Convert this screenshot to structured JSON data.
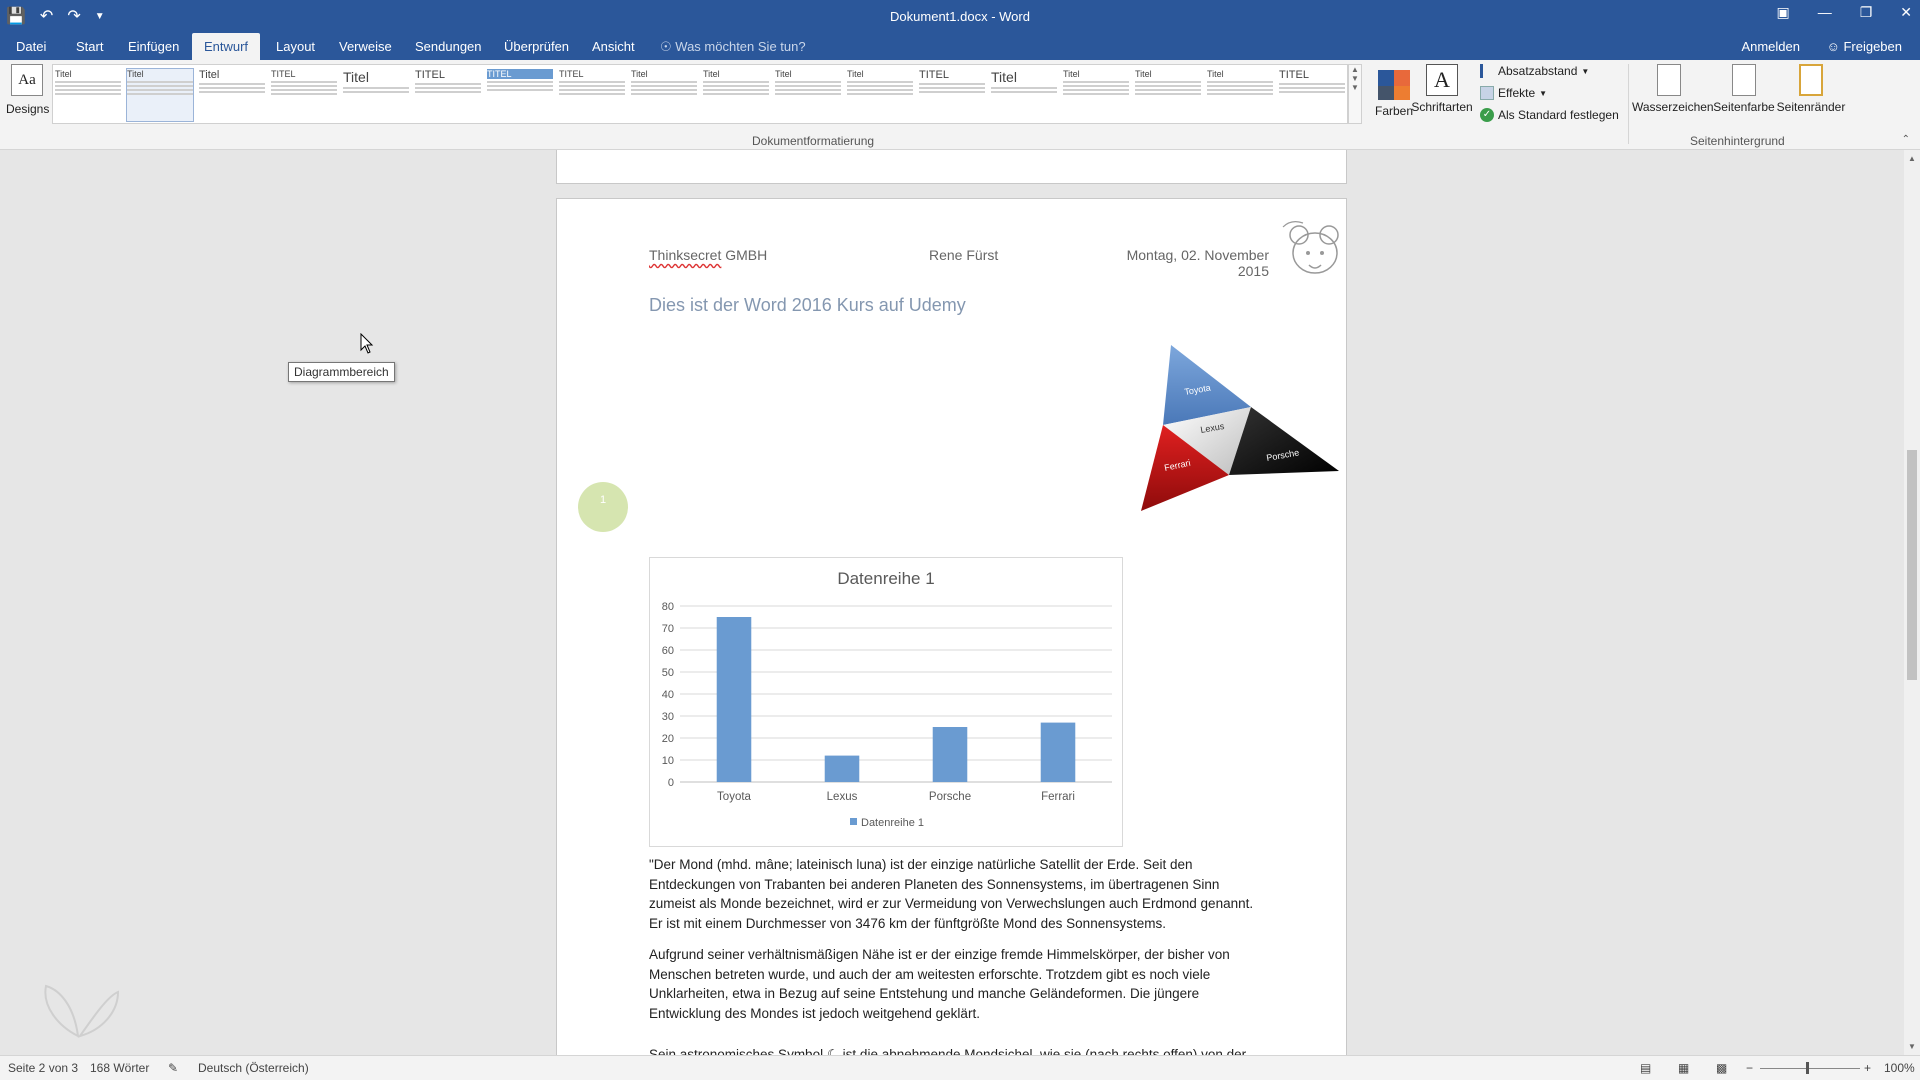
{
  "titlebar": {
    "title": "Dokument1.docx - Word"
  },
  "tabs": [
    "Datei",
    "Start",
    "Einfügen",
    "Entwurf",
    "Layout",
    "Verweise",
    "Sendungen",
    "Überprüfen",
    "Ansicht"
  ],
  "tellme": "Was möchten Sie tun?",
  "signin": "Anmelden",
  "share": "Freigeben",
  "ribbon": {
    "designs_label": "Designs",
    "group_label": "Dokumentformatierung",
    "farben": "Farben",
    "schriftarten": "Schriftarten",
    "absatzabstand": "Absatzabstand",
    "effekte": "Effekte",
    "standard": "Als Standard festlegen",
    "wasserzeichen": "Wasserzeichen",
    "seitenfarbe": "Seitenfarbe",
    "seitenraender": "Seitenränder",
    "bg_group_label": "Seitenhintergrund",
    "style_titles": [
      "Titel",
      "Titel",
      "Titel",
      "TITEL",
      "Titel",
      "TITEL",
      "TITEL",
      "TITEL",
      "Titel",
      "Titel",
      "Titel",
      "Titel",
      "TITEL",
      "Titel",
      "Titel",
      "Titel",
      "Titel",
      "TITEL"
    ]
  },
  "tooltip": "Diagrammbereich",
  "page": {
    "header_company_prefix": "Thinksecret",
    "header_company_suffix": " GMBH",
    "header_name": "Rene Fürst",
    "header_date": "Montag, 02. November 2015",
    "heading": "Dies ist der Word 2016 Kurs auf Udemy",
    "comment_number": "1",
    "paragraphs": [
      "\"Der Mond (mhd. mâne; lateinisch luna) ist der einzige natürliche Satellit der Erde. Seit den Entdeckungen von Trabanten bei anderen Planeten des Sonnensystems, im übertragenen Sinn zumeist als Monde bezeichnet, wird er zur Vermeidung von Verwechslungen auch Erdmond genannt. Er ist mit einem Durchmesser von 3476 km der fünftgrößte Mond des Sonnensystems.",
      "Aufgrund seiner verhältnismäßigen Nähe ist er der einzige fremde Himmelskörper, der bisher von Menschen betreten wurde, und auch der am weitesten erforschte. Trotzdem gibt es noch viele Unklarheiten, etwa in Bezug auf seine Entstehung und manche Geländeformen. Die jüngere Entwicklung des Mondes ist jedoch weitgehend geklärt.",
      "Sein astronomisches Symbol ☾ ist die abnehmende Mondsichel, wie sie (nach rechts offen) von der"
    ],
    "pyramid_labels": [
      "Toyota",
      "Lexus",
      "Ferrari",
      "Porsche"
    ]
  },
  "chart_data": {
    "type": "bar",
    "title": "Datenreihe 1",
    "categories": [
      "Toyota",
      "Lexus",
      "Porsche",
      "Ferrari"
    ],
    "series": [
      {
        "name": "Datenreihe 1",
        "values": [
          75,
          12,
          25,
          27
        ]
      }
    ],
    "ylim": [
      0,
      80
    ],
    "yticks": [
      "0",
      "10",
      "20",
      "30",
      "40",
      "50",
      "60",
      "70",
      "80"
    ],
    "grid": true,
    "legend": "bottom",
    "color": "#6a9bd1"
  },
  "status": {
    "page": "Seite 2 von 3",
    "words": "168 Wörter",
    "language": "Deutsch (Österreich)",
    "zoom": "100%"
  }
}
